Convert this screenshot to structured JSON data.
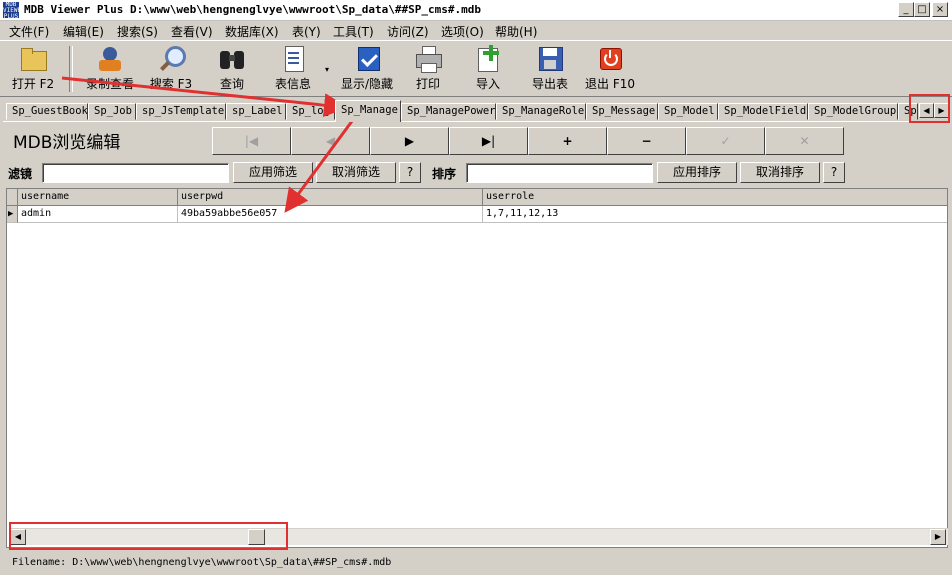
{
  "window": {
    "app_icon_text": "MDB VIEWER PLUS",
    "title": "MDB Viewer Plus D:\\www\\web\\hengnenglvye\\wwwroot\\Sp_data\\##SP_cms#.mdb",
    "minimize": "_",
    "maximize": "□",
    "close": "×"
  },
  "menu": [
    "文件(F)",
    "编辑(E)",
    "搜索(S)",
    "查看(V)",
    "数据库(X)",
    "表(Y)",
    "工具(T)",
    "访问(Z)",
    "选项(O)",
    "帮助(H)"
  ],
  "toolbar": {
    "open": "打开 F2",
    "record_view": "录制查看",
    "search": "搜索 F3",
    "query": "查询",
    "table_info": "表信息",
    "show_hide": "显示/隐藏",
    "print": "打印",
    "import": "导入",
    "export": "导出表",
    "exit": "退出 F10"
  },
  "tabs": [
    "Sp_GuestBook",
    "Sp_Job",
    "sp_JsTemplate",
    "sp_Label",
    "Sp_log",
    "Sp_Manage",
    "Sp_ManagePower",
    "Sp_ManageRole",
    "Sp_Message",
    "Sp_Model",
    "Sp_ModelField",
    "Sp_ModelGroup",
    "Sp"
  ],
  "active_tab": "Sp_Manage",
  "panel": {
    "title": "MDB浏览编辑",
    "nav": {
      "first": "|◀",
      "prev": "◀",
      "next": "▶",
      "last": "▶|",
      "add": "+",
      "delete": "−",
      "post": "✓",
      "cancel": "✕"
    },
    "filter_label": "滤镜",
    "filter_value": "",
    "apply_filter": "应用筛选",
    "cancel_filter": "取消筛选",
    "help": "?",
    "sort_label": "排序",
    "sort_value": "",
    "apply_sort": "应用排序",
    "cancel_sort": "取消排序"
  },
  "grid": {
    "columns": [
      "username",
      "userpwd",
      "userrole"
    ],
    "rows": [
      [
        "admin",
        "49ba59abbe56e057",
        "1,7,11,12,13"
      ]
    ]
  },
  "status": {
    "filename": "Filename: D:\\www\\web\\hengnenglvye\\wwwroot\\Sp_data\\##SP_cms#.mdb"
  },
  "colors": {
    "annotation_red": "#e03030",
    "face": "#d4d0c8"
  }
}
